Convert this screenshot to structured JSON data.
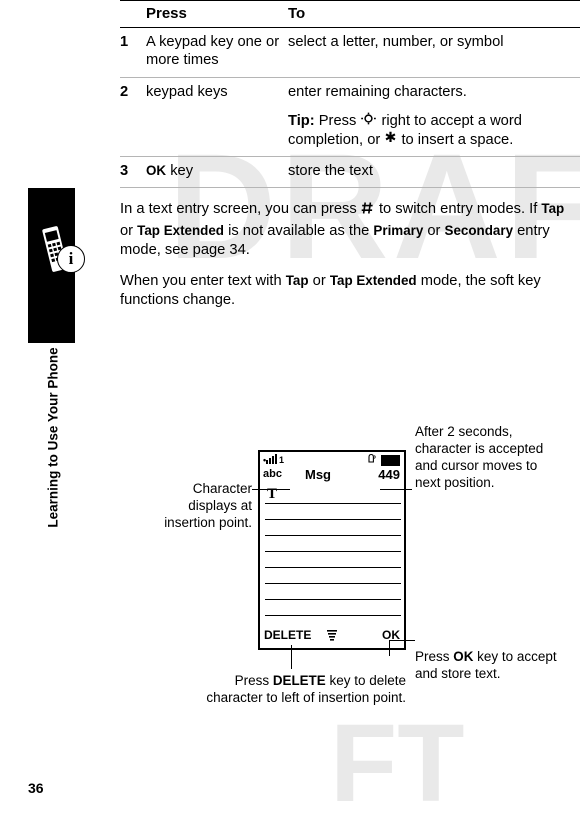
{
  "sidebar": {
    "label": "Learning to Use Your Phone",
    "phone_icon": "mobile-phone-icon",
    "info_icon": "i"
  },
  "page_number": "36",
  "watermark": {
    "text1": "DRAFT",
    "text2": "FT"
  },
  "table": {
    "headers": {
      "num": "",
      "press": "Press",
      "to": "To"
    },
    "rows": [
      {
        "num": "1",
        "press": "A keypad key one or more times",
        "to": "select a letter, number, or symbol",
        "tip": ""
      },
      {
        "num": "2",
        "press": "keypad keys",
        "to": "enter remaining characters.",
        "tip_label": "Tip:",
        "tip_text_1": "Press",
        "tip_nav_icon": "navigation-key-icon",
        "tip_text_2": "right to accept a word completion, or",
        "tip_star_icon": "star-key-icon",
        "tip_text_3": "to insert a space."
      },
      {
        "num": "3",
        "press_key": "OK",
        "press_suffix": "key",
        "to": "store the text"
      }
    ]
  },
  "paragraphs": {
    "p1_part1": "In a text entry screen, you can press",
    "p1_pound_icon": "pound-key-icon",
    "p1_part2": "to switch entry modes. If",
    "p1_tap": "Tap",
    "p1_or": "or",
    "p1_tap_extended": "Tap Extended",
    "p1_part3": "is not available as the",
    "p1_primary": "Primary",
    "p1_or2": "or",
    "p1_secondary": "Secondary",
    "p1_part4": "entry mode, see page 34.",
    "p2_part1": "When you enter text with",
    "p2_tap": "Tap",
    "p2_or": "or",
    "p2_tap_extended": "Tap Extended",
    "p2_part2": "mode, the soft key functions change."
  },
  "phone_display": {
    "signal_icon": "signal-strength-icon",
    "bell_icon": "ringer-icon",
    "battery_icon": "battery-icon",
    "entry_mode": "abc",
    "title": "Msg",
    "char_count": "449",
    "cursor_char": "T",
    "softkey_left": "DELETE",
    "softkey_center_icon": "menu-icon",
    "softkey_right": "OK"
  },
  "callouts": {
    "left_1": "Character displays at insertion point.",
    "right_1": "After 2 seconds, character is accepted and cursor moves to next position.",
    "right_2_part1": "Press",
    "right_2_key": "OK",
    "right_2_part2": "key to accept and store text.",
    "bottom_part1": "Press",
    "bottom_key": "DELETE",
    "bottom_part2": "key to delete character to left of insertion point."
  }
}
